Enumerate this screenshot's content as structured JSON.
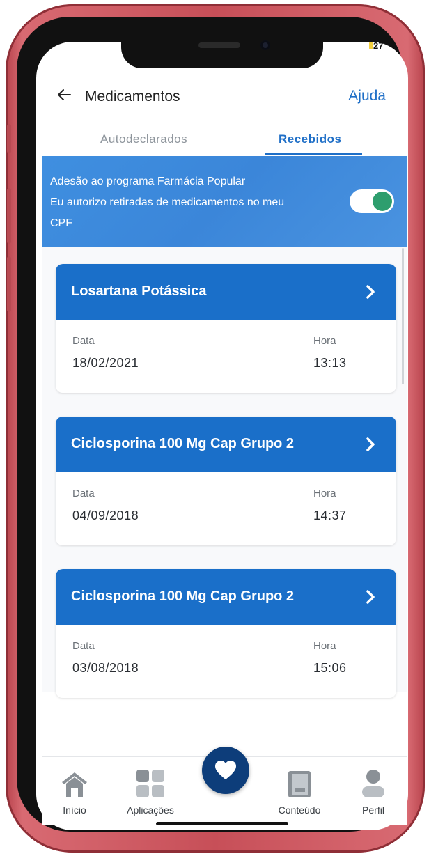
{
  "status_bar": {
    "battery": "27"
  },
  "header": {
    "title": "Medicamentos",
    "help": "Ajuda"
  },
  "tabs": [
    {
      "label": "Autodeclarados",
      "active": false
    },
    {
      "label": "Recebidos",
      "active": true
    }
  ],
  "banner": {
    "line1": "Adesão ao programa Farmácia Popular",
    "line2": "Eu autorizo retiradas de medicamentos no meu",
    "line3": "CPF",
    "toggle_on": true
  },
  "cards": [
    {
      "name": "Losartana Potássica",
      "date_label": "Data",
      "date": "18/02/2021",
      "time_label": "Hora",
      "time": "13:13"
    },
    {
      "name": "Ciclosporina 100 Mg Cap Grupo 2",
      "date_label": "Data",
      "date": "04/09/2018",
      "time_label": "Hora",
      "time": "14:37"
    },
    {
      "name": "Ciclosporina 100 Mg Cap Grupo 2",
      "date_label": "Data",
      "date": "03/08/2018",
      "time_label": "Hora",
      "time": "15:06"
    }
  ],
  "bottom_nav": [
    {
      "label": "Início",
      "icon": "home-icon"
    },
    {
      "label": "Aplicações",
      "icon": "apps-grid-icon"
    },
    {
      "label": "",
      "icon": "heart-icon"
    },
    {
      "label": "Conteúdo",
      "icon": "book-icon"
    },
    {
      "label": "Perfil",
      "icon": "person-icon"
    }
  ],
  "colors": {
    "primary": "#1a6fc9",
    "banner": "#3b86d9",
    "toggle_knob": "#2e9e6e",
    "fab": "#0d3d7a",
    "frame": "#c74f58"
  }
}
